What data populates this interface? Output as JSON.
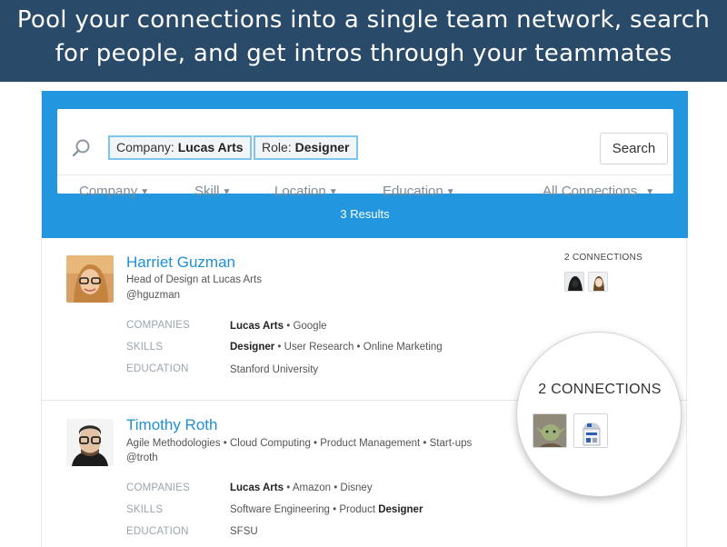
{
  "banner": {
    "line1": "Pool your connections into a single team network, search",
    "line2": "for people, and get intros through your teammates"
  },
  "search": {
    "chips": [
      {
        "key": "Company:",
        "value": "Lucas Arts"
      },
      {
        "key": "Role:",
        "value": "Designer"
      }
    ],
    "button_label": "Search"
  },
  "filters": [
    "Company",
    "Skill",
    "Location",
    "Education",
    "All Connections"
  ],
  "results_text": "3 Results",
  "field_labels": {
    "companies": "COMPANIES",
    "skills": "SKILLS",
    "education": "EDUCATION"
  },
  "people": [
    {
      "name": "Harriet Guzman",
      "headline": "Head of Design at Lucas Arts",
      "handle": "@hguzman",
      "companies": [
        {
          "text": "Lucas Arts",
          "bold": true
        },
        {
          "text": "Google",
          "bold": false
        }
      ],
      "skills": [
        {
          "text": "Designer",
          "bold": true
        },
        {
          "text": "User Research",
          "bold": false
        },
        {
          "text": "Online Marketing",
          "bold": false
        }
      ],
      "education": "Stanford University",
      "connections_label": "2 CONNECTIONS"
    },
    {
      "name": "Timothy Roth",
      "headline": "Agile Methodologies • Cloud Computing • Product Management • Start-ups",
      "handle": "@troth",
      "companies": [
        {
          "text": "Lucas Arts",
          "bold": true
        },
        {
          "text": "Amazon",
          "bold": false
        },
        {
          "text": "Disney",
          "bold": false
        }
      ],
      "skills": [
        {
          "text": "Software Engineering",
          "bold": false
        },
        {
          "text": "Product ",
          "bold": false
        },
        {
          "text": "Designer",
          "bold": true
        }
      ],
      "education": "SFSU"
    }
  ],
  "magnifier": {
    "title": "2 CONNECTIONS"
  },
  "colors": {
    "banner": "#2a4a6a",
    "accent": "#2296de",
    "link": "#1f8fd6"
  },
  "icons": {
    "search": "magnifier-icon",
    "caret": "caret-down-icon"
  }
}
